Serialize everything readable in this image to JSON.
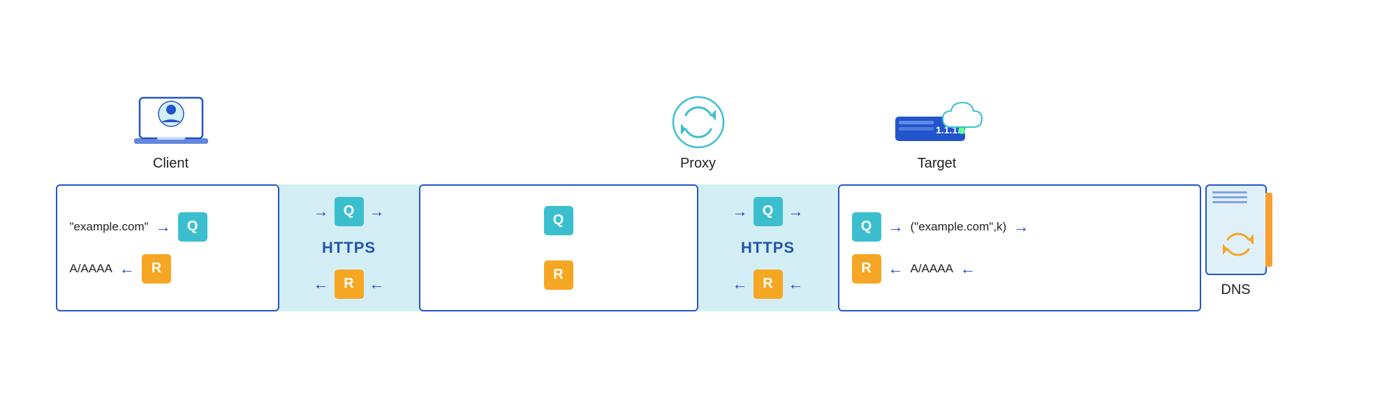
{
  "icons": {
    "client_label": "Client",
    "proxy_label": "Proxy",
    "target_label": "Target",
    "dns_label": "DNS"
  },
  "flow": {
    "https_label": "HTTPS",
    "q_label": "Q",
    "r_label": "R",
    "client_query_text": "\"example.com\"",
    "client_response_text": "A/AAAA",
    "target_query_text": "(\"example.com\",k)",
    "target_response_text": "A/AAAA"
  }
}
